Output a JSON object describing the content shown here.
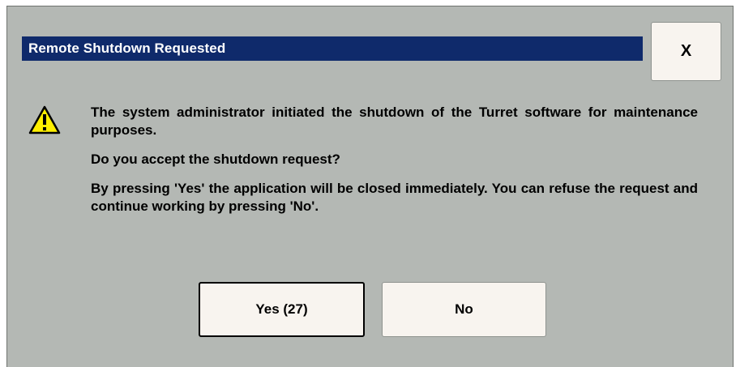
{
  "dialog": {
    "title": "Remote Shutdown Requested",
    "close_label": "X",
    "icon": "warning-triangle-icon",
    "message": {
      "paragraph_1": "The system administrator initiated the shutdown of the Turret software for maintenance purposes.",
      "paragraph_2": "Do you accept the shutdown request?",
      "paragraph_3": "By pressing 'Yes' the application will be closed immediately. You can refuse the request and continue working by pressing 'No'."
    },
    "buttons": {
      "yes_label": "Yes (27)",
      "no_label": "No"
    }
  },
  "colors": {
    "title_bar": "#0f2a6b",
    "dialog_background": "#b4b8b4",
    "button_face": "#f8f4ef",
    "warning_fill": "#ffef00"
  }
}
